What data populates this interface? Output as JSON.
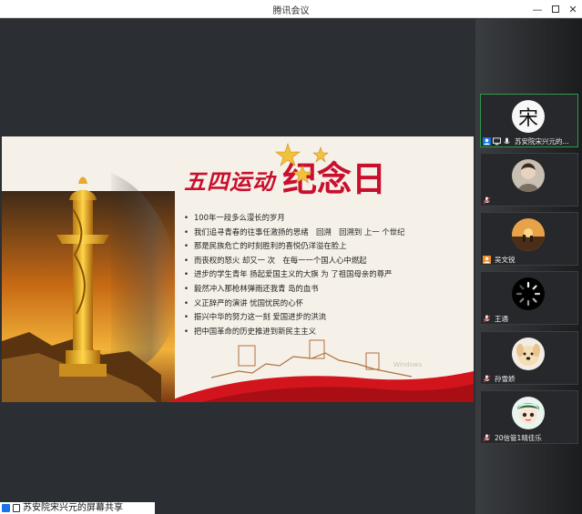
{
  "window": {
    "title": "腾讯会议"
  },
  "slide": {
    "title_left": "五四运动",
    "title_right": "纪念日",
    "bullets": [
      "100年一段多么漫长的岁月",
      "我们追寻青春的往事任激扬的思绪　回溯　回溯到 上一 个世纪",
      "那是民族危亡的时刻胜利的喜悦仍洋溢在脸上",
      "而丧权的怒火  却又一 次　在每一一个国人心中燃起",
      "进步的学生青年  扬起爱国主义的大旗  为 了祖国母亲的尊严",
      "毅然冲入那枪林弹雨还我青 岛的血书",
      "义正辞严的演讲  忧国忧民的心怀",
      "振兴中华的努力这一刻  爱国进步的洪流",
      "把中国革命的历史推进到新民主主义"
    ],
    "watermark": "Windows"
  },
  "presenter_bar": {
    "text": "苏安院宋兴元的屏幕共享"
  },
  "participants": [
    {
      "name": "苏安院宋兴元的...",
      "avatar_char": "宋",
      "active": true,
      "icons": [
        "user-icon",
        "screen-share-icon",
        "mic-icon"
      ]
    },
    {
      "name": "",
      "avatar_char": "",
      "active": false,
      "icons": [
        "mic-muted-icon"
      ]
    },
    {
      "name": "吴文锐",
      "avatar_char": "",
      "active": false,
      "icons": [
        "user-orange-icon"
      ]
    },
    {
      "name": "王通",
      "avatar_char": "",
      "active": false,
      "icons": [
        "mic-muted-icon"
      ]
    },
    {
      "name": "孙雪娇",
      "avatar_char": "",
      "active": false,
      "icons": [
        "mic-muted-icon"
      ]
    },
    {
      "name": "20信管1晴佳乐",
      "avatar_char": "",
      "active": false,
      "icons": [
        "mic-muted-icon"
      ]
    }
  ],
  "colors": {
    "accent_red": "#c8102e",
    "active_border": "#2e9a4a",
    "share_blue": "#1a73e8"
  }
}
